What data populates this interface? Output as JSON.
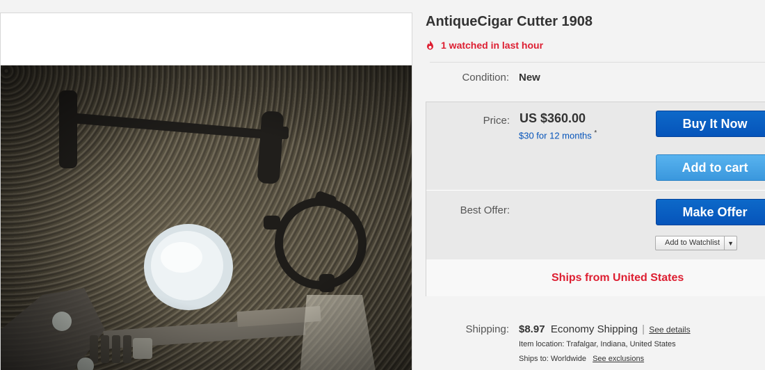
{
  "item": {
    "title": "AntiqueCigar Cutter 1908",
    "watch_text": "1 watched in last hour"
  },
  "condition": {
    "label": "Condition:",
    "value": "New"
  },
  "price": {
    "label": "Price:",
    "value": "US $360.00",
    "financing": "$30 for 12 months",
    "financing_mark": "*"
  },
  "actions": {
    "buy_now": "Buy It Now",
    "add_to_cart": "Add to cart",
    "make_offer": "Make Offer",
    "add_to_watchlist": "Add to Watchlist"
  },
  "best_offer": {
    "label": "Best Offer:"
  },
  "ships_from": "Ships from United States",
  "shipping": {
    "label": "Shipping:",
    "cost": "$8.97",
    "method": "Economy Shipping",
    "separator": "|",
    "details_link": "See details",
    "item_location_label": "Item location:",
    "item_location": "Trafalgar, Indiana, United States",
    "ships_to_label": "Ships to:",
    "ships_to": "Worldwide",
    "exclusions_link": "See exclusions"
  },
  "colors": {
    "accent_red": "#dd1e31",
    "button_blue": "#0654ba",
    "button_light_blue": "#3a97dd",
    "link_blue": "#0654ba"
  }
}
